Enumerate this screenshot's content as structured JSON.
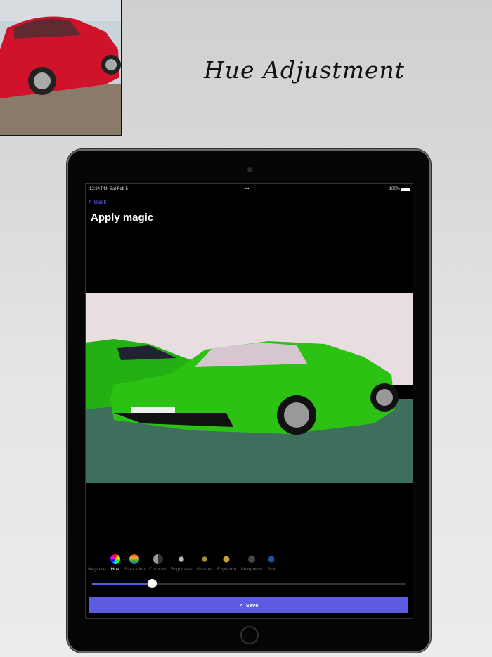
{
  "promo_title": "Hue Adjustment",
  "status": {
    "time": "12:24 PM",
    "date": "Sat Feb 5",
    "battery": "100%"
  },
  "nav": {
    "back": "Back",
    "title": "Apply magic"
  },
  "tools": [
    {
      "label": "Negative",
      "icon": "negative-icon"
    },
    {
      "label": "Hue",
      "icon": "hue-wheel-icon",
      "active": true
    },
    {
      "label": "Saturation",
      "icon": "saturation-icon"
    },
    {
      "label": "Contrast",
      "icon": "contrast-icon"
    },
    {
      "label": "Brightness",
      "icon": "brightness-icon"
    },
    {
      "label": "Gamma",
      "icon": "gamma-icon"
    },
    {
      "label": "Exposure",
      "icon": "exposure-icon"
    },
    {
      "label": "Sharpness",
      "icon": "sharpness-icon"
    },
    {
      "label": "Blur",
      "icon": "blur-icon"
    }
  ],
  "slider_value": 0.19,
  "save_label": "Save",
  "accent": "#5d5ce0"
}
